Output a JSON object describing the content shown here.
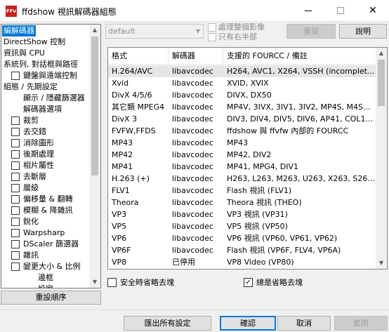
{
  "window": {
    "title": "ffdshow 視訊解碼器組態",
    "app_icon_text": "FFv"
  },
  "tree": {
    "items": [
      {
        "label": "編解碼器",
        "selected": true,
        "checkbox": false,
        "indent": 0
      },
      {
        "label": "DirectShow 控制",
        "checkbox": false,
        "indent": 0
      },
      {
        "label": "資訊與 CPU",
        "checkbox": false,
        "indent": 0
      },
      {
        "label": "系統列, 對話框與路徑",
        "checkbox": false,
        "indent": 0
      },
      {
        "label": "鍵盤與遠端控制",
        "checkbox": true,
        "indent": 1
      },
      {
        "label": "組態 / 先期設定",
        "checkbox": false,
        "indent": 0
      },
      {
        "label": "顯示 / 隱藏篩選器",
        "checkbox": false,
        "indent": 2
      },
      {
        "label": "解碼器選項",
        "checkbox": false,
        "indent": 2
      },
      {
        "label": "裁剪",
        "checkbox": true,
        "indent": 1
      },
      {
        "label": "去交錯",
        "checkbox": true,
        "indent": 1
      },
      {
        "label": "消除圖形",
        "checkbox": true,
        "indent": 1
      },
      {
        "label": "後期處理",
        "checkbox": true,
        "indent": 1
      },
      {
        "label": "相片屬性",
        "checkbox": true,
        "indent": 1
      },
      {
        "label": "去斷層",
        "checkbox": true,
        "indent": 1
      },
      {
        "label": "層級",
        "checkbox": true,
        "indent": 1
      },
      {
        "label": "偏移量 & 翻轉",
        "checkbox": true,
        "indent": 1
      },
      {
        "label": "模糊 & 降雜訊",
        "checkbox": true,
        "indent": 1
      },
      {
        "label": "銳化",
        "checkbox": true,
        "indent": 1
      },
      {
        "label": "Warpsharp",
        "checkbox": true,
        "indent": 1
      },
      {
        "label": "DScaler 篩選器",
        "checkbox": true,
        "indent": 1
      },
      {
        "label": "雜訊",
        "checkbox": true,
        "indent": 1
      },
      {
        "label": "變更大小 & 比例",
        "checkbox": true,
        "indent": 1
      },
      {
        "label": "邊框",
        "checkbox": false,
        "indent": 3
      },
      {
        "label": "設定",
        "checkbox": false,
        "indent": 3
      }
    ],
    "reset_order_label": "重設順序"
  },
  "top": {
    "preset_value": "default",
    "process_whole_image": "處理整個影像",
    "right_half_only": "只有右半部",
    "reset_label": "重設",
    "help_label": "說明"
  },
  "list": {
    "headers": [
      "格式",
      "解碼器",
      "支援的 FOURCC / 備註"
    ],
    "rows": [
      [
        "H.264/AVC",
        "libavcodec",
        "H264, AVC1, X264, VSSH (incomplet..."
      ],
      [
        "Xvid",
        "libavcodec",
        "XVID, XVIX"
      ],
      [
        "DivX 4/5/6",
        "libavcodec",
        "DIVX, DX50"
      ],
      [
        "其它類 MPEG4",
        "libavcodec",
        "MP4V, 3IVX, 3IV1, 3IV2, MP4S, M4S..."
      ],
      [
        "DivX 3",
        "libavcodec",
        "DIV3, DIV4, DIV5, DIV6, AP41, COL1..."
      ],
      [
        "FVFW,FFDS",
        "libavcodec",
        "ffdshow 與 ffvfw 內部的 FOURCC"
      ],
      [
        "MP43",
        "libavcodec",
        "MP43"
      ],
      [
        "MP42",
        "libavcodec",
        "MP42, DIV2"
      ],
      [
        "MP41",
        "libavcodec",
        "MP41, MPG4, DIV1"
      ],
      [
        "H.263 (+)",
        "libavcodec",
        "H263, L263, M263, U263, X263, S26..."
      ],
      [
        "FLV1",
        "libavcodec",
        "Flash 視訊 (FLV1)"
      ],
      [
        "Theora",
        "libavcodec",
        "Theora 視訊 (THEO)"
      ],
      [
        "VP3",
        "libavcodec",
        "VP3 視訊 (VP31)"
      ],
      [
        "VP5",
        "libavcodec",
        "VP5 視訊 (VP50)"
      ],
      [
        "VP6",
        "libavcodec",
        "VP6 視訊 (VP60, VP61, VP62)"
      ],
      [
        "VP6F",
        "libavcodec",
        "Flash 視訊 (VP6F, FLV4, VP6A)"
      ],
      [
        "VP8",
        "已停用",
        "VP8 Video (VP80)"
      ]
    ]
  },
  "options": {
    "safe_skip_loop": "安全時省略去塊",
    "always_skip_loop": "總是省略去塊",
    "always_skip_checked": "✓"
  },
  "footer": {
    "export_label": "匯出所有設定",
    "ok_label": "確認",
    "cancel_label": "取消",
    "apply_label": "套用"
  }
}
